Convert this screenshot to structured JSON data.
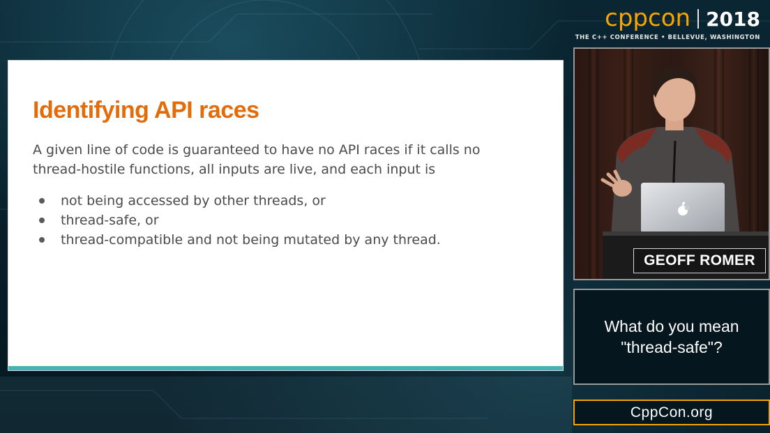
{
  "brand": {
    "logo_text": "cppcon",
    "year": "2018",
    "subtitle": "THE C++ CONFERENCE • BELLEVUE, WASHINGTON",
    "accent_color": "#f7a600"
  },
  "slide": {
    "title": "Identifying API races",
    "intro": "A given line of code is guaranteed to have no API races if it calls no thread-hostile functions, all inputs are live, and each input is",
    "bullets": [
      "not being accessed by other threads, or",
      "thread-safe, or",
      "thread-compatible and not being mutated by any thread."
    ],
    "title_color": "#e36c09",
    "bar_color": "#43b3b5"
  },
  "speaker": {
    "name": "GEOFF ROMER",
    "laptop_logo": "apple-icon"
  },
  "session": {
    "title": "What do you mean\n\"thread-safe\"?"
  },
  "footer": {
    "website": "CppCon.org",
    "border_color": "#f2a400"
  }
}
